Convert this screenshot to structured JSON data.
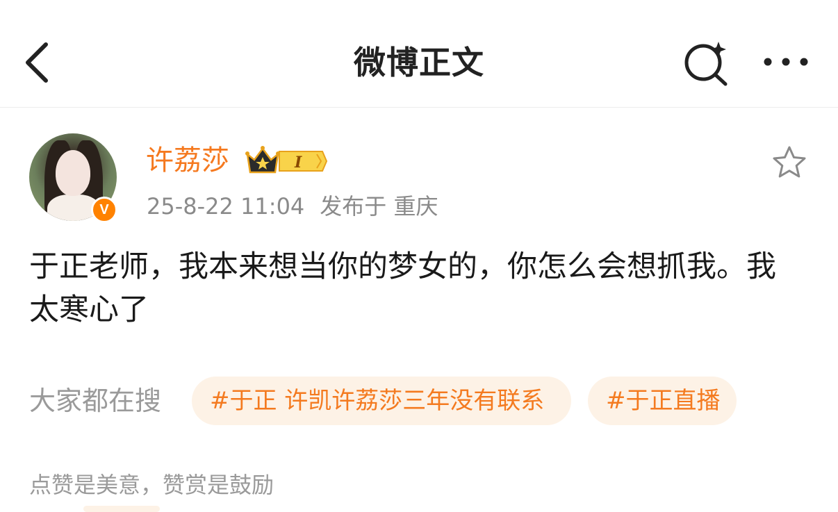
{
  "header": {
    "title": "微博正文",
    "back_icon": "chevron-left-icon",
    "search_icon": "search-sparkle-icon",
    "more_icon": "more-dots-icon"
  },
  "author": {
    "name": "许荔莎",
    "vip_level": "I",
    "verified": "V",
    "post_time": "25-8-22 11:04",
    "location": "发布于 重庆",
    "name_color": "#f5791f"
  },
  "post": {
    "text": "于正老师，我本来想当你的梦女的，你怎么会想抓我。我太寒心了"
  },
  "hot_search": {
    "label": "大家都在搜",
    "tags": [
      "#于正 许凯许荔莎三年没有联系",
      "#于正直播"
    ],
    "tag_color": "#f47a1f",
    "tag_bg": "#fdf2e6"
  },
  "footer": {
    "reward_text": "点赞是美意，赞赏是鼓励"
  }
}
